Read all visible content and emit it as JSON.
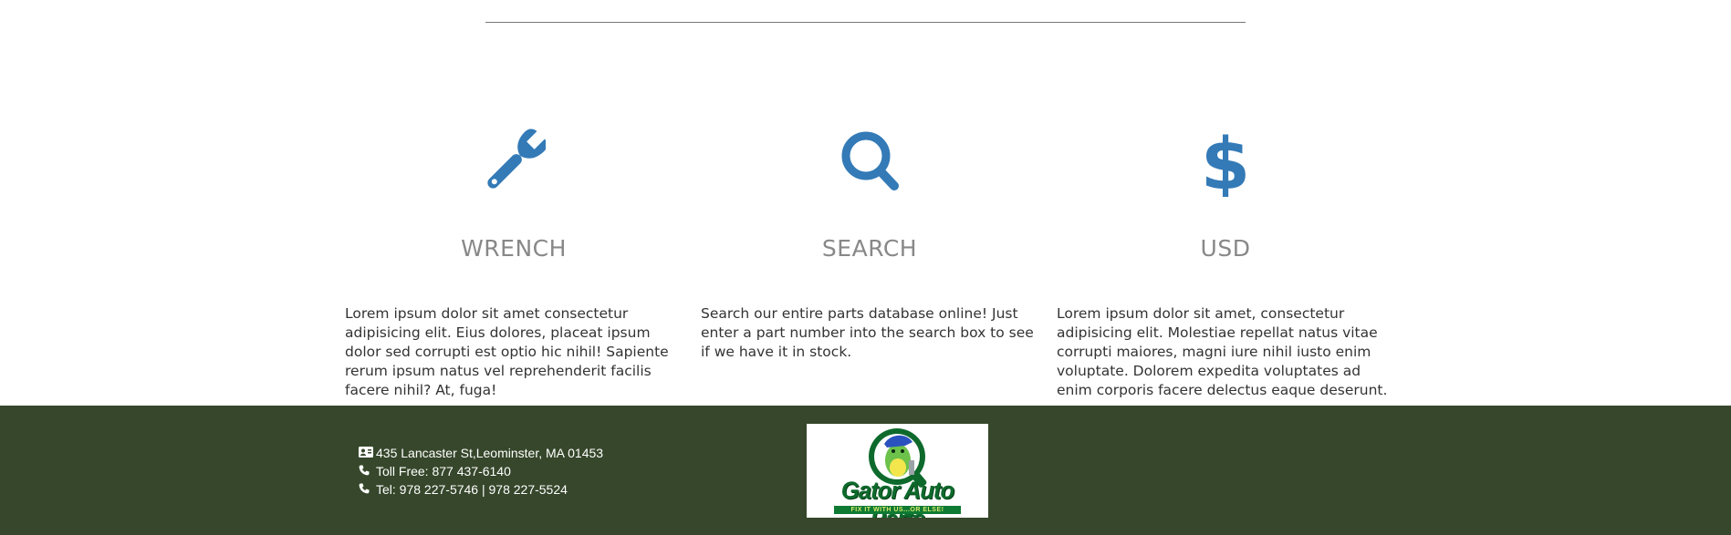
{
  "features": [
    {
      "icon": "wrench-icon",
      "title": "WRENCH",
      "text": "Lorem ipsum dolor sit amet consectetur adipisicing elit. Eius dolores, placeat ipsum dolor sed corrupti est optio hic nihil! Sapiente rerum ipsum natus vel reprehenderit facilis facere nihil? At, fuga!"
    },
    {
      "icon": "search-icon",
      "title": "SEARCH",
      "text": "Search our entire parts database online! Just enter a part number into the search box to see if we have it in stock."
    },
    {
      "icon": "dollar-icon",
      "title": "USD",
      "text": "Lorem ipsum dolor sit amet, consectetur adipisicing elit. Molestiae repellat natus vitae corrupti maiores, magni iure nihil iusto enim voluptate. Dolorem expedita voluptates ad enim corporis facere delectus eaque deserunt."
    }
  ],
  "footer": {
    "address": "435 Lancaster St,Leominster, MA 01453",
    "toll_free": "Toll Free: 877 437-6140",
    "tel": "Tel: 978 227-5746 | 978 227-5524",
    "logo_text": "Gator Auto Parts",
    "logo_tagline": "FIX IT WITH US...OR ELSE!"
  },
  "colors": {
    "icon_blue": "#337ab7",
    "footer_bg": "#36472b",
    "title_gray": "#888888"
  }
}
